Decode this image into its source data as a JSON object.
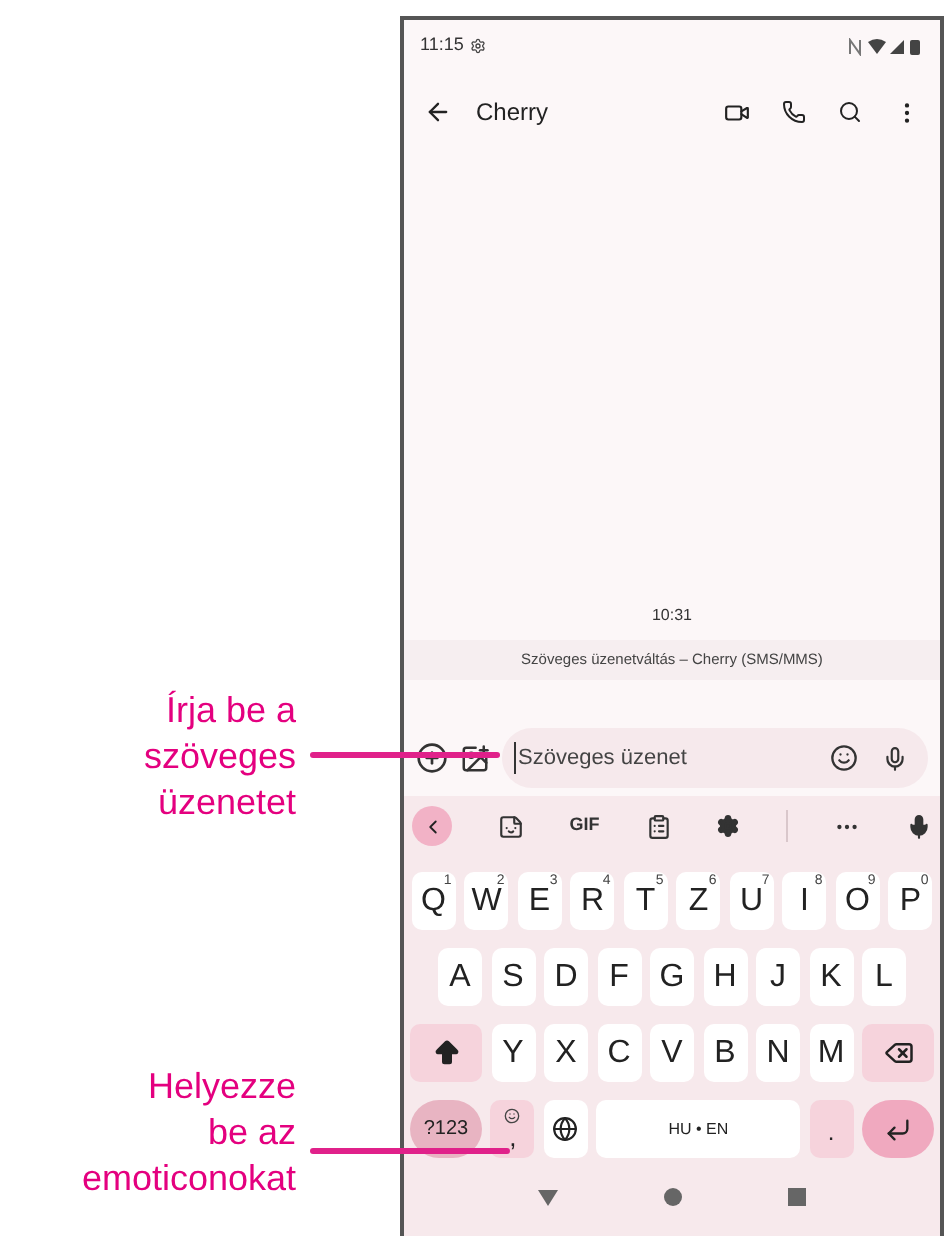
{
  "callouts": [
    {
      "text": "Írja be a\nszöveges\nüzenetet",
      "kind": "compose"
    },
    {
      "text": "Helyezze\nbe az\nemoticonokat",
      "kind": "emoji"
    }
  ],
  "status_bar": {
    "time": "11:15"
  },
  "app_bar": {
    "title": "Cherry"
  },
  "conversation": {
    "timestamp": "10:31",
    "thread_label": "Szöveges üzenetváltás – Cherry (SMS/MMS)"
  },
  "compose": {
    "placeholder": "Szöveges üzenet"
  },
  "keyboard_toolbar": {
    "gif_label": "GIF"
  },
  "keyboard_rows": [
    [
      {
        "kind": "letter",
        "label": "Q",
        "hint": "1"
      },
      {
        "kind": "letter",
        "label": "W",
        "hint": "2"
      },
      {
        "kind": "letter",
        "label": "E",
        "hint": "3"
      },
      {
        "kind": "letter",
        "label": "R",
        "hint": "4"
      },
      {
        "kind": "letter",
        "label": "T",
        "hint": "5"
      },
      {
        "kind": "letter",
        "label": "Z",
        "hint": "6"
      },
      {
        "kind": "letter",
        "label": "U",
        "hint": "7"
      },
      {
        "kind": "letter",
        "label": "I",
        "hint": "8"
      },
      {
        "kind": "letter",
        "label": "O",
        "hint": "9"
      },
      {
        "kind": "letter",
        "label": "P",
        "hint": "0"
      }
    ],
    [
      {
        "kind": "letter",
        "label": "A"
      },
      {
        "kind": "letter",
        "label": "S"
      },
      {
        "kind": "letter",
        "label": "D"
      },
      {
        "kind": "letter",
        "label": "F"
      },
      {
        "kind": "letter",
        "label": "G"
      },
      {
        "kind": "letter",
        "label": "H"
      },
      {
        "kind": "letter",
        "label": "J"
      },
      {
        "kind": "letter",
        "label": "K"
      },
      {
        "kind": "letter",
        "label": "L"
      }
    ],
    [
      {
        "kind": "shift"
      },
      {
        "kind": "letter",
        "label": "Y"
      },
      {
        "kind": "letter",
        "label": "X"
      },
      {
        "kind": "letter",
        "label": "C"
      },
      {
        "kind": "letter",
        "label": "V"
      },
      {
        "kind": "letter",
        "label": "B"
      },
      {
        "kind": "letter",
        "label": "N"
      },
      {
        "kind": "letter",
        "label": "M"
      },
      {
        "kind": "backspace"
      }
    ],
    [
      {
        "kind": "symbols",
        "label": "?123"
      },
      {
        "kind": "comma",
        "label": ","
      },
      {
        "kind": "globe"
      },
      {
        "kind": "space",
        "label": "HU • EN"
      },
      {
        "kind": "period",
        "label": "."
      },
      {
        "kind": "enter"
      }
    ]
  ]
}
